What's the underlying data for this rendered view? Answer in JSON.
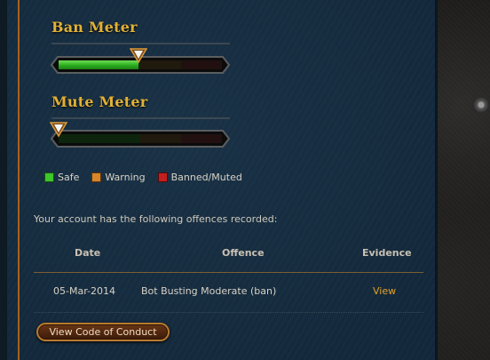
{
  "ban_meter": {
    "title": "Ban Meter",
    "level": 0.49
  },
  "mute_meter": {
    "title": "Mute Meter",
    "level": 0.0
  },
  "legend": [
    {
      "label": "Safe",
      "color": "#3ec62a"
    },
    {
      "label": "Warning",
      "color": "#d9852a"
    },
    {
      "label": "Banned/Muted",
      "color": "#c21f1f"
    }
  ],
  "offences": {
    "intro": "Your account has the following offences recorded:",
    "headers": {
      "date": "Date",
      "offence": "Offence",
      "evidence": "Evidence"
    },
    "rows": [
      {
        "date": "05-Mar-2014",
        "offence": "Bot Busting Moderate (ban)",
        "evidence": "View"
      }
    ]
  },
  "conduct_button": "View Code of Conduct",
  "colors": {
    "panel_bg": "#13283b",
    "accent_gold": "#e2b136",
    "link_orange": "#e2a229"
  }
}
